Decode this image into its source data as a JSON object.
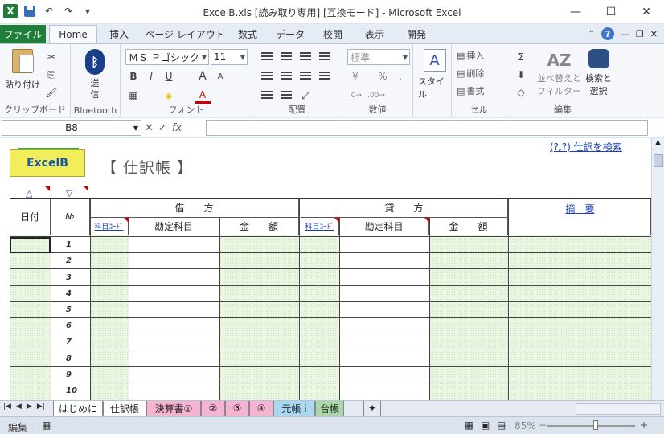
{
  "window": {
    "title": "ExcelB.xls  [読み取り専用]  [互換モード] - Microsoft Excel",
    "minimize": "—",
    "maximize": "☐",
    "close": "✕"
  },
  "qat": {
    "excel_logo": "X",
    "undo": "↶",
    "redo": "↷",
    "dropdown": "▾"
  },
  "ribbon_tabs": {
    "file": "ファイル",
    "home": "Home",
    "insert": "挿入",
    "layout": "ページ レイアウト",
    "formulas": "数式",
    "data": "データ",
    "review": "校閲",
    "view": "表示",
    "developer": "開発"
  },
  "ribbon": {
    "clipboard": {
      "paste": "貼り付け",
      "label": "クリップボード"
    },
    "bluetooth": {
      "send": "送信",
      "label": "Bluetooth"
    },
    "font": {
      "name": "ＭＳ Ｐゴシック",
      "size": "11",
      "bold": "B",
      "italic": "I",
      "underline": "U",
      "grow": "A",
      "shrink": "A",
      "color_a": "A",
      "label": "フォント"
    },
    "alignment": {
      "label": "配置"
    },
    "number": {
      "format": "標準",
      "percent": "%",
      "comma": ",",
      "label": "数値"
    },
    "style": {
      "styles": "スタイル"
    },
    "cells": {
      "insert": "挿入",
      "delete": "削除",
      "format": "書式",
      "label": "セル"
    },
    "editing": {
      "sigma": "Σ",
      "sort": "並べ替えと",
      "sort2": "フィルター",
      "find": "検索と",
      "find2": "選択",
      "label": "編集"
    }
  },
  "formula_bar": {
    "name_box": "B8",
    "cancel": "✕",
    "enter": "✓",
    "fx": "fx",
    "value": ""
  },
  "sheet": {
    "logo_text": "ExcelB",
    "title": "【 仕訳帳 】",
    "search_link": "(?,?) 仕訳を検索",
    "sort_up": "△",
    "sort_down": "▽",
    "headers": {
      "date": "日付",
      "no": "№",
      "debit": "借　　方",
      "credit": "貸　　方",
      "summary": "摘　要",
      "code": "科目ｺｰﾄﾞ",
      "account": "勘定科目",
      "amount": "金　　額"
    },
    "rows": [
      "1",
      "2",
      "3",
      "4",
      "5",
      "6",
      "7",
      "8",
      "9",
      "10"
    ]
  },
  "sheet_tabs": [
    {
      "label": "はじめに",
      "color": "#ffffff"
    },
    {
      "label": "仕訳帳",
      "color": "#ffffff"
    },
    {
      "label": "決算書①",
      "color": "#f7b3d2"
    },
    {
      "label": "②",
      "color": "#f7b3d2"
    },
    {
      "label": "③",
      "color": "#f7b3d2"
    },
    {
      "label": "④",
      "color": "#f7b3d2"
    },
    {
      "label": "元帳 i",
      "color": "#a8d8f2"
    },
    {
      "label": "台帳",
      "color": "#a8d8a8"
    }
  ],
  "status_bar": {
    "mode": "編集",
    "zoom": "85%",
    "minus": "−",
    "plus": "+"
  }
}
